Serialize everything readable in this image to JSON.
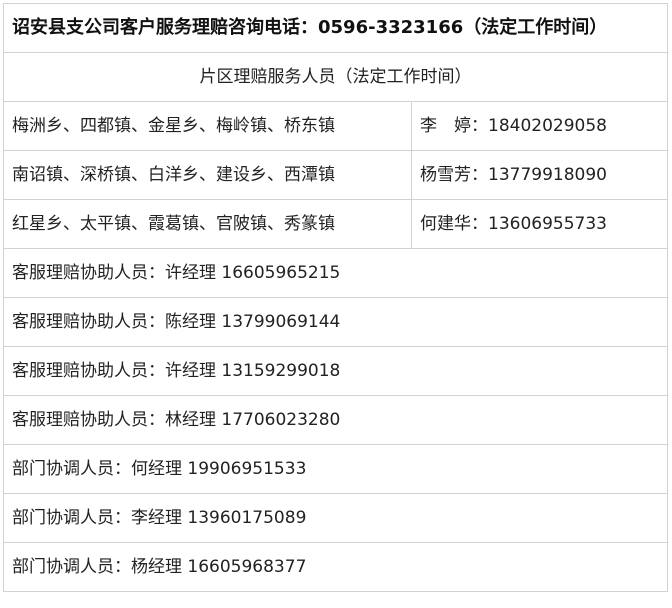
{
  "title": "诏安县支公司客户服务理赔咨询电话：0596-3323166（法定工作时间）",
  "section_header": "片区理赔服务人员（法定工作时间）",
  "regions": [
    {
      "areas": "梅洲乡、四都镇、金星乡、梅岭镇、桥东镇",
      "contact": "李　婷：18402029058"
    },
    {
      "areas": "南诏镇、深桥镇、白洋乡、建设乡、西潭镇",
      "contact": "杨雪芳：13779918090"
    },
    {
      "areas": "红星乡、太平镇、霞葛镇、官陂镇、秀篆镇",
      "contact": "何建华：13606955733"
    }
  ],
  "staff": [
    "客服理赔协助人员：许经理 16605965215",
    "客服理赔协助人员：陈经理 13799069144",
    "客服理赔协助人员：许经理 13159299018",
    "客服理赔协助人员：林经理 17706023280",
    "部门协调人员：何经理 19906951533",
    "部门协调人员：李经理 13960175089",
    "部门协调人员：杨经理 16605968377"
  ]
}
